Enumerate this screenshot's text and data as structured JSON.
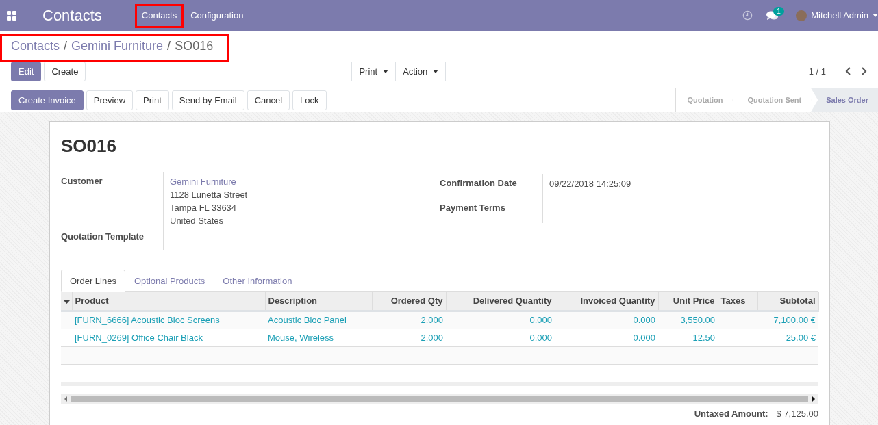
{
  "navbar": {
    "app_title": "Contacts",
    "menu": [
      {
        "label": "Contacts",
        "highlighted": true
      },
      {
        "label": "Configuration",
        "highlighted": false
      }
    ],
    "messages_badge": "1",
    "user": "Mitchell Admin"
  },
  "breadcrumbs": {
    "items": [
      "Contacts",
      "Gemini Furniture",
      "SO016"
    ],
    "separators": [
      "/",
      "/"
    ],
    "highlighted": true
  },
  "control_buttons": [
    {
      "label": "Edit",
      "kind": "primary"
    },
    {
      "label": "Create",
      "kind": "secondary"
    }
  ],
  "dropdowns": [
    "Print",
    "Action"
  ],
  "pager": "1 / 1",
  "actions": [
    {
      "label": "Create Invoice",
      "kind": "primary"
    },
    {
      "label": "Preview",
      "kind": "secondary"
    },
    {
      "label": "Print",
      "kind": "secondary"
    },
    {
      "label": "Send by Email",
      "kind": "secondary"
    },
    {
      "label": "Cancel",
      "kind": "secondary"
    },
    {
      "label": "Lock",
      "kind": "secondary"
    }
  ],
  "stages": [
    {
      "label": "Quotation",
      "selected": false
    },
    {
      "label": "Quotation Sent",
      "selected": false
    },
    {
      "label": "Sales Order",
      "selected": true
    }
  ],
  "record": {
    "title": "SO016",
    "left_fields": [
      {
        "label": "Customer",
        "lines": [
          "Gemini Furniture",
          "1128 Lunetta Street",
          "Tampa FL 33634",
          "United States"
        ]
      },
      {
        "label": "Quotation Template"
      }
    ],
    "right_fields": [
      {
        "label": "Confirmation Date",
        "lines": [
          "09/22/2018 14:25:09"
        ]
      },
      {
        "label": "Payment Terms"
      }
    ]
  },
  "tabs": [
    {
      "label": "Order Lines",
      "selected": true
    },
    {
      "label": "Optional Products",
      "selected": false
    },
    {
      "label": "Other Information",
      "selected": false
    }
  ],
  "table": {
    "columns": [
      "Product",
      "Description",
      "Ordered Qty",
      "Delivered Quantity",
      "Invoiced Quantity",
      "Unit Price",
      "Taxes",
      "Subtotal"
    ],
    "rows": [
      [
        "[FURN_6666] Acoustic Bloc Screens",
        "Acoustic Bloc Panel",
        "2.000",
        "0.000",
        "0.000",
        "3,550.00",
        "",
        "7,100.00 €"
      ],
      [
        "[FURN_0269] Office Chair Black",
        "Mouse, Wireless",
        "2.000",
        "0.000",
        "0.000",
        "12.50",
        "",
        "25.00 €"
      ]
    ]
  },
  "totals": [
    {
      "label": "Untaxed Amount:",
      "value": "$ 7,125.00"
    }
  ]
}
